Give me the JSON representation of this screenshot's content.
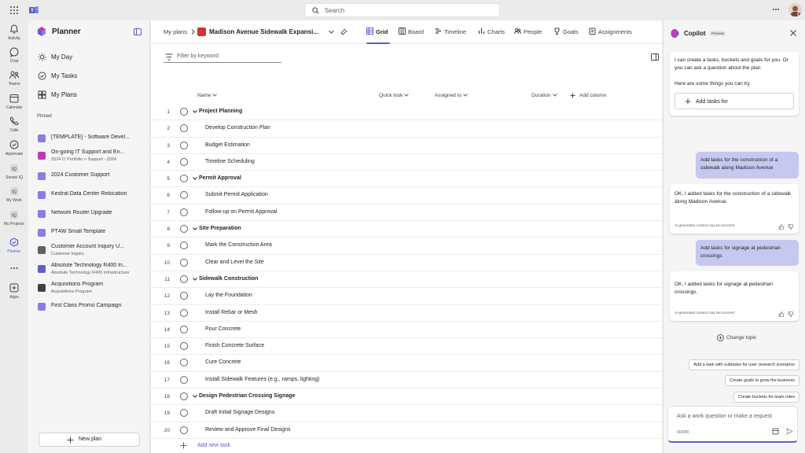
{
  "topbar": {
    "search_placeholder": "Search"
  },
  "rail": [
    {
      "label": "Activity",
      "icon": "bell-icon"
    },
    {
      "label": "Chat",
      "icon": "chat-icon"
    },
    {
      "label": "Teams",
      "icon": "teams-icon"
    },
    {
      "label": "Calendar",
      "icon": "calendar-icon"
    },
    {
      "label": "Calls",
      "icon": "phone-icon"
    },
    {
      "label": "Approvals",
      "icon": "approvals-icon"
    },
    {
      "label": "Sensei IQ",
      "icon": "iq-icon"
    },
    {
      "label": "My Work",
      "icon": "iq-icon"
    },
    {
      "label": "My Projects",
      "icon": "iq-icon"
    },
    {
      "label": "Planner",
      "icon": "planner-icon"
    },
    {
      "label": "",
      "icon": "more-icon"
    },
    {
      "label": "Apps",
      "icon": "apps-icon"
    }
  ],
  "sidebar": {
    "title": "Planner",
    "nav": [
      {
        "label": "My Day",
        "icon": "sun-icon"
      },
      {
        "label": "My Tasks",
        "icon": "check-circle-icon"
      },
      {
        "label": "My Plans",
        "icon": "grid-icon"
      }
    ],
    "pinned_label": "Pinned",
    "pinned": [
      {
        "title": "[TEMPLATE] - Software Devel...",
        "sub": "",
        "color": "#8a7ee0"
      },
      {
        "title": "On-going IT Support and En...",
        "sub": "2024 IT Portfolio  >  Support - 2024",
        "color": "#c239b3"
      },
      {
        "title": "2024 Customer Support",
        "sub": "",
        "color": "#8a7ee0"
      },
      {
        "title": "Kestral Data Center Relocation",
        "sub": "",
        "color": "#8a7ee0"
      },
      {
        "title": "Network Router Upgrade",
        "sub": "",
        "color": "#8a7ee0"
      },
      {
        "title": "PT4W Small Template",
        "sub": "",
        "color": "#8a7ee0"
      },
      {
        "title": "Customer Account Inquiry U...",
        "sub": "Customer Inquiry",
        "color": "#616161"
      },
      {
        "title": "Absolute Technology R400 In...",
        "sub": "Absolute Technology R400 Infrastructure",
        "color": "#5b5fc7"
      },
      {
        "title": "Acquisitions Program",
        "sub": "Acquisitions Program",
        "color": "#424242"
      },
      {
        "title": "First Class Promo Campaign",
        "sub": "",
        "color": "#8a7ee0"
      }
    ],
    "new_plan": "New plan"
  },
  "header": {
    "breadcrumb": "My plans",
    "plan_title": "Madison Avenue Sidewalk Expansi...",
    "tabs": [
      {
        "label": "Grid",
        "icon": "grid-icon",
        "active": true
      },
      {
        "label": "Board",
        "icon": "board-icon",
        "active": false
      },
      {
        "label": "Timeline",
        "icon": "timeline-icon",
        "active": false
      },
      {
        "label": "Charts",
        "icon": "chart-icon",
        "active": false
      },
      {
        "label": "People",
        "icon": "people-icon",
        "active": false
      },
      {
        "label": "Goals",
        "icon": "goal-icon",
        "active": false
      },
      {
        "label": "Assignments",
        "icon": "assignments-icon",
        "active": false
      }
    ]
  },
  "grid": {
    "filter_placeholder": "Filter by keyword",
    "columns": {
      "name": "Name",
      "quick_look": "Quick look",
      "assigned_to": "Assigned to",
      "duration": "Duration",
      "add_column": "Add column"
    },
    "rows": [
      {
        "n": "1",
        "title": "Project Planning",
        "bucket": true
      },
      {
        "n": "2",
        "title": "Develop Construction Plan",
        "bucket": false
      },
      {
        "n": "3",
        "title": "Budget Estimation",
        "bucket": false
      },
      {
        "n": "4",
        "title": "Timeline Scheduling",
        "bucket": false
      },
      {
        "n": "5",
        "title": "Permit Approval",
        "bucket": true
      },
      {
        "n": "6",
        "title": "Submit Permit Application",
        "bucket": false
      },
      {
        "n": "7",
        "title": "Follow-up on Permit Approval",
        "bucket": false
      },
      {
        "n": "8",
        "title": "Site Preparation",
        "bucket": true
      },
      {
        "n": "9",
        "title": "Mark the Construction Area",
        "bucket": false
      },
      {
        "n": "10",
        "title": "Clear and Level the Site",
        "bucket": false
      },
      {
        "n": "11",
        "title": "Sidewalk Construction",
        "bucket": true
      },
      {
        "n": "12",
        "title": "Lay the Foundation",
        "bucket": false
      },
      {
        "n": "13",
        "title": "Install Rebar or Mesh",
        "bucket": false
      },
      {
        "n": "14",
        "title": "Pour Concrete",
        "bucket": false
      },
      {
        "n": "15",
        "title": "Finish Concrete Surface",
        "bucket": false
      },
      {
        "n": "16",
        "title": "Cure Concrete",
        "bucket": false
      },
      {
        "n": "17",
        "title": "Install Sidewalk Features (e.g., ramps, lighting)",
        "bucket": false
      },
      {
        "n": "18",
        "title": "Design Pedestrian Crossing Signage",
        "bucket": true
      },
      {
        "n": "19",
        "title": "Draft Initial Signage Designs",
        "bucket": false
      },
      {
        "n": "20",
        "title": "Review and Approve Final Designs",
        "bucket": false
      }
    ],
    "add_task": "Add new task"
  },
  "copilot": {
    "title": "Copilot",
    "badge": "Preview",
    "intro": "I can create a tasks, buckets and goals for you. Or you can ask a question about the plan",
    "intro2": "Here are some things you can try",
    "add_tasks_btn": "Add tasks for",
    "user1": "Add tasks for the construction of a sidewalk along Madison Avenue",
    "bot1": "OK, I added tasks for the construction of a sidewalk along Madison Avenue.",
    "disclaimer": "AI-generated content may be incorrect",
    "user2": "Add tasks for signage at pedestrian crossings",
    "bot2": "OK, I added tasks for signage at pedestrian crossings.",
    "change_topic": "Change topic",
    "suggestions": [
      "Add a task with subtasks for user research scenarios",
      "Create goals to grow the business",
      "Create buckets for team roles"
    ],
    "composer_placeholder": "Ask a work question or make a request",
    "char_count": "0/2000"
  }
}
